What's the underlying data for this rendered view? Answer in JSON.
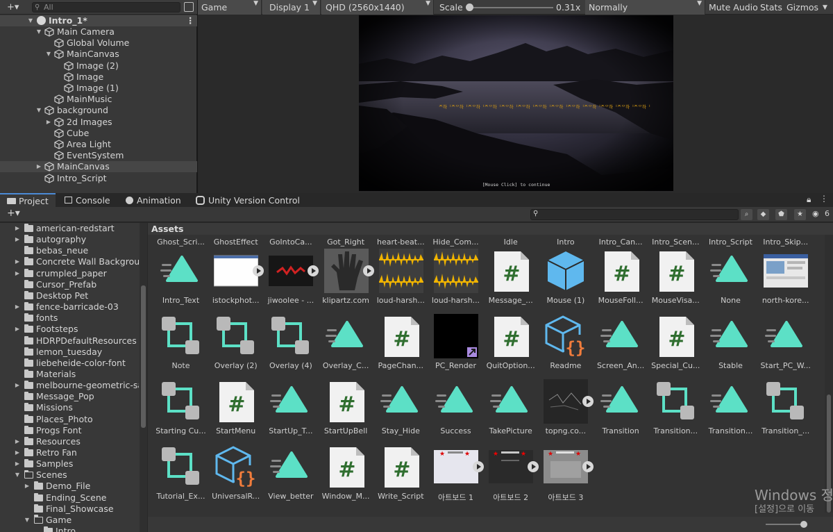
{
  "hierarchy": {
    "add_label": "+▾",
    "search_placeholder": "All",
    "scene_name": "Intro_1*",
    "menu_glyph": "⋮",
    "items": [
      {
        "label": "Main Camera",
        "depth": 1,
        "fold": "open"
      },
      {
        "label": "Global Volume",
        "depth": 2,
        "fold": "none"
      },
      {
        "label": "MainCanvas",
        "depth": 2,
        "fold": "open"
      },
      {
        "label": "Image (2)",
        "depth": 3,
        "fold": "none"
      },
      {
        "label": "Image",
        "depth": 3,
        "fold": "none"
      },
      {
        "label": "Image (1)",
        "depth": 3,
        "fold": "none"
      },
      {
        "label": "MainMusic",
        "depth": 2,
        "fold": "none"
      },
      {
        "label": "background",
        "depth": 1,
        "fold": "open"
      },
      {
        "label": "2d Images",
        "depth": 2,
        "fold": "closed"
      },
      {
        "label": "Cube",
        "depth": 2,
        "fold": "none"
      },
      {
        "label": "Area Light",
        "depth": 2,
        "fold": "none"
      },
      {
        "label": "EventSystem",
        "depth": 2,
        "fold": "none"
      },
      {
        "label": "MainCanvas",
        "depth": 1,
        "fold": "closed",
        "selected": true
      },
      {
        "label": "Intro_Script",
        "depth": 1,
        "fold": "none"
      }
    ]
  },
  "game_view": {
    "mode": "Game",
    "display": "Display 1",
    "resolution": "QHD (2560x1440)",
    "scale_label": "Scale",
    "scale_value": "0.31x",
    "play_focus": "Normally",
    "mute_audio": "Mute Audio",
    "stats": "Stats",
    "gizmos": "Gizmos",
    "dialogue_text": "ᄌ하ᅵᄌᄋ하ᅵᄌᄋ하ᅵᄌᄋ하ᅵᄌᄋ하ᅵᄌᄋ하ᅵᄌᄋ하ᅵᄌᄋ하ᅵᄌᄋ하ᅵᄌᄋ하ᅵᄌᄋ하ᅵᄌᄋ하ᅵᄌᄋ하ᅵ",
    "continue_text": "[Mouse Click] to continue",
    "accent_color": "#d59a14"
  },
  "bottom_tabs": [
    {
      "label": "Project",
      "icon": "folder-icon",
      "active": true
    },
    {
      "label": "Console",
      "icon": "console-icon"
    },
    {
      "label": "Animation",
      "icon": "animation-clock-icon"
    },
    {
      "label": "Unity Version Control",
      "icon": "version-control-icon"
    }
  ],
  "project_toolbar": {
    "add_label": "+▾",
    "hidden_count": "6"
  },
  "folders": [
    {
      "label": "american-redstart",
      "depth": 1,
      "fold": "closed"
    },
    {
      "label": "autography",
      "depth": 1,
      "fold": "closed"
    },
    {
      "label": "bebas_neue",
      "depth": 1,
      "fold": "none"
    },
    {
      "label": "Concrete Wall Background",
      "depth": 1,
      "fold": "closed"
    },
    {
      "label": "crumpled_paper",
      "depth": 1,
      "fold": "closed"
    },
    {
      "label": "Cursor_Prefab",
      "depth": 1,
      "fold": "none"
    },
    {
      "label": "Desktop Pet",
      "depth": 1,
      "fold": "none"
    },
    {
      "label": "fence-barricade-03",
      "depth": 1,
      "fold": "closed"
    },
    {
      "label": "fonts",
      "depth": 1,
      "fold": "none"
    },
    {
      "label": "Footsteps",
      "depth": 1,
      "fold": "closed"
    },
    {
      "label": "HDRPDefaultResources",
      "depth": 1,
      "fold": "none"
    },
    {
      "label": "lemon_tuesday",
      "depth": 1,
      "fold": "none"
    },
    {
      "label": "liebeheide-color-font",
      "depth": 1,
      "fold": "none"
    },
    {
      "label": "Materials",
      "depth": 1,
      "fold": "none"
    },
    {
      "label": "melbourne-geometric-sar",
      "depth": 1,
      "fold": "closed"
    },
    {
      "label": "Message_Pop",
      "depth": 1,
      "fold": "none"
    },
    {
      "label": "Missions",
      "depth": 1,
      "fold": "none"
    },
    {
      "label": "Places_Photo",
      "depth": 1,
      "fold": "none"
    },
    {
      "label": "Progs Font",
      "depth": 1,
      "fold": "none"
    },
    {
      "label": "Resources",
      "depth": 1,
      "fold": "closed"
    },
    {
      "label": "Retro Fan",
      "depth": 1,
      "fold": "closed"
    },
    {
      "label": "Samples",
      "depth": 1,
      "fold": "closed"
    },
    {
      "label": "Scenes",
      "depth": 1,
      "fold": "open"
    },
    {
      "label": "Demo_File",
      "depth": 2,
      "fold": "closed"
    },
    {
      "label": "Ending_Scene",
      "depth": 2,
      "fold": "none"
    },
    {
      "label": "Final_Showcase",
      "depth": 2,
      "fold": "none"
    },
    {
      "label": "Game",
      "depth": 2,
      "fold": "open"
    },
    {
      "label": "Intro",
      "depth": 3,
      "fold": "none"
    }
  ],
  "assets": {
    "heading": "Assets",
    "top_row": [
      "Ghost_Scri...",
      "GhostEffect",
      "GoIntoCa...",
      "Got_Right",
      "heart-beat...",
      "Hide_Com...",
      "Idle",
      "Intro",
      "Intro_Can...",
      "Intro_Scen...",
      "Intro_Script",
      "Intro_Skip..."
    ],
    "rows": [
      [
        {
          "label": "Intro_Text",
          "icon": "anim-clip-icon"
        },
        {
          "label": "istockphot...",
          "icon": "image-white-icon",
          "play": true
        },
        {
          "label": "jiwoolee - ...",
          "icon": "image-red-scribble-icon",
          "play": true
        },
        {
          "label": "klipartz.com",
          "icon": "image-handprint-icon",
          "play": true
        },
        {
          "label": "loud-harsh...",
          "icon": "audio-waveform-icon"
        },
        {
          "label": "loud-harsh...",
          "icon": "audio-waveform-icon"
        },
        {
          "label": "Message_...",
          "icon": "csharp-script-icon"
        },
        {
          "label": "Mouse (1)",
          "icon": "prefab-icon"
        },
        {
          "label": "MouseFoll...",
          "icon": "csharp-script-icon"
        },
        {
          "label": "MouseVisa...",
          "icon": "csharp-script-icon"
        },
        {
          "label": "None",
          "icon": "anim-clip-icon"
        },
        {
          "label": "north-kore...",
          "icon": "image-screenshot-icon"
        }
      ],
      [
        {
          "label": "Note",
          "icon": "anim-controller-icon"
        },
        {
          "label": "Overlay (2)",
          "icon": "anim-controller-icon"
        },
        {
          "label": "Overlay (4)",
          "icon": "anim-controller-icon"
        },
        {
          "label": "Overlay_C...",
          "icon": "anim-clip-icon"
        },
        {
          "label": "PageChan...",
          "icon": "csharp-script-icon"
        },
        {
          "label": "PC_Render",
          "icon": "render-texture-icon"
        },
        {
          "label": "QuitOption...",
          "icon": "csharp-script-icon"
        },
        {
          "label": "Readme",
          "icon": "script-asset-icon"
        },
        {
          "label": "Screen_An...",
          "icon": "anim-clip-icon"
        },
        {
          "label": "Special_Cu...",
          "icon": "csharp-script-icon"
        },
        {
          "label": "Stable",
          "icon": "anim-clip-icon"
        },
        {
          "label": "Start_PC_W...",
          "icon": "anim-clip-icon"
        }
      ],
      [
        {
          "label": "Starting Cu...",
          "icon": "anim-controller-icon"
        },
        {
          "label": "StartMenu",
          "icon": "csharp-script-icon"
        },
        {
          "label": "StartUp_T...",
          "icon": "anim-clip-icon"
        },
        {
          "label": "StartUpBell",
          "icon": "csharp-script-icon"
        },
        {
          "label": "Stay_Hide",
          "icon": "anim-clip-icon"
        },
        {
          "label": "Success",
          "icon": "anim-clip-icon"
        },
        {
          "label": "TakePicture",
          "icon": "anim-clip-icon"
        },
        {
          "label": "topng.co...",
          "icon": "image-dark-icon",
          "play": true
        },
        {
          "label": "Transition",
          "icon": "anim-clip-icon"
        },
        {
          "label": "Transition...",
          "icon": "anim-controller-icon"
        },
        {
          "label": "Transition...",
          "icon": "anim-clip-icon"
        },
        {
          "label": "Transition_...",
          "icon": "anim-controller-icon"
        }
      ],
      [
        {
          "label": "Tutorial_Ex...",
          "icon": "anim-controller-icon"
        },
        {
          "label": "UniversalR...",
          "icon": "script-asset-icon"
        },
        {
          "label": "View_better",
          "icon": "anim-clip-icon"
        },
        {
          "label": "Window_M...",
          "icon": "csharp-script-icon"
        },
        {
          "label": "Write_Script",
          "icon": "csharp-script-icon"
        },
        {
          "label": "아트보드 1",
          "icon": "artboard-light-icon",
          "play": true
        },
        {
          "label": "아트보드 2",
          "icon": "artboard-dark-icon",
          "play": true
        },
        {
          "label": "아트보드 3",
          "icon": "artboard-gray-icon",
          "play": true
        }
      ]
    ]
  },
  "watermark": {
    "line1": "Windows 정",
    "line2": "[설정]으로 이동"
  }
}
